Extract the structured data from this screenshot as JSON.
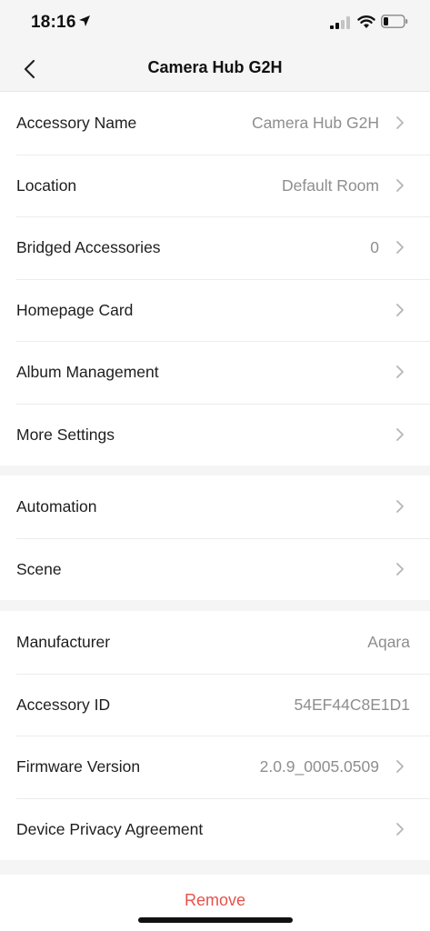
{
  "status_bar": {
    "time": "18:16"
  },
  "nav": {
    "title": "Camera Hub G2H"
  },
  "group1": [
    {
      "label": "Accessory Name",
      "value": "Camera Hub G2H"
    },
    {
      "label": "Location",
      "value": "Default Room"
    },
    {
      "label": "Bridged Accessories",
      "value": "0"
    },
    {
      "label": "Homepage Card",
      "value": ""
    },
    {
      "label": "Album Management",
      "value": ""
    },
    {
      "label": "More Settings",
      "value": ""
    }
  ],
  "group2": [
    {
      "label": "Automation"
    },
    {
      "label": "Scene"
    }
  ],
  "group3": [
    {
      "label": "Manufacturer",
      "value": "Aqara"
    },
    {
      "label": "Accessory ID",
      "value": "54EF44C8E1D1"
    },
    {
      "label": "Firmware Version",
      "value": "2.0.9_0005.0509"
    },
    {
      "label": "Device Privacy Agreement",
      "value": ""
    }
  ],
  "remove_label": "Remove",
  "colors": {
    "remove": "#e5534b",
    "value_text": "#8e8e8e",
    "background": "#f5f5f5"
  }
}
